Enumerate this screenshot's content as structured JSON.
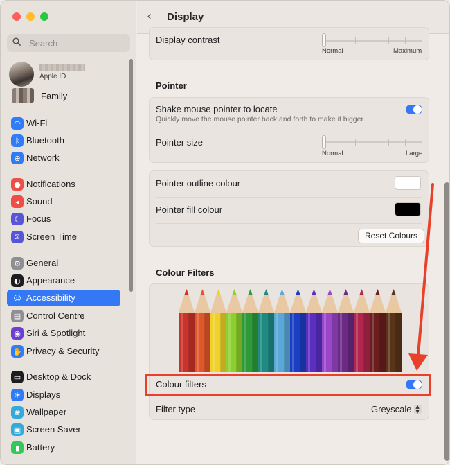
{
  "window": {
    "title": "Display"
  },
  "sidebar": {
    "search_placeholder": "Search",
    "account": {
      "subtitle": "Apple ID",
      "family_label": "Family"
    },
    "items": [
      {
        "label": "Wi-Fi",
        "icon": "wifi-icon",
        "color": "#2f7cf6"
      },
      {
        "label": "Bluetooth",
        "icon": "bluetooth-icon",
        "color": "#2f7cf6"
      },
      {
        "label": "Network",
        "icon": "network-globe-icon",
        "color": "#2f7cf6"
      },
      {
        "label": "Notifications",
        "icon": "notifications-bell-icon",
        "color": "#ee4e45"
      },
      {
        "label": "Sound",
        "icon": "sound-speaker-icon",
        "color": "#ee4e45"
      },
      {
        "label": "Focus",
        "icon": "focus-moon-icon",
        "color": "#5856d6"
      },
      {
        "label": "Screen Time",
        "icon": "screen-time-hourglass-icon",
        "color": "#5856d6"
      },
      {
        "label": "General",
        "icon": "general-gear-icon",
        "color": "#8e8e93"
      },
      {
        "label": "Appearance",
        "icon": "appearance-circle-icon",
        "color": "#1d1d1f"
      },
      {
        "label": "Accessibility",
        "icon": "accessibility-person-icon",
        "color": "#2f7cf6",
        "active": true
      },
      {
        "label": "Control Centre",
        "icon": "control-centre-icon",
        "color": "#8e8e93"
      },
      {
        "label": "Siri & Spotlight",
        "icon": "siri-icon",
        "color": "#6c3fd0"
      },
      {
        "label": "Privacy & Security",
        "icon": "privacy-hand-icon",
        "color": "#2f7cf6"
      },
      {
        "label": "Desktop & Dock",
        "icon": "desktop-dock-icon",
        "color": "#1d1d1f"
      },
      {
        "label": "Displays",
        "icon": "displays-sun-icon",
        "color": "#2f7cf6"
      },
      {
        "label": "Wallpaper",
        "icon": "wallpaper-flower-icon",
        "color": "#34aadc"
      },
      {
        "label": "Screen Saver",
        "icon": "screen-saver-icon",
        "color": "#34aadc"
      },
      {
        "label": "Battery",
        "icon": "battery-icon",
        "color": "#34c759"
      }
    ]
  },
  "main": {
    "contrast": {
      "label": "Display contrast",
      "min_label": "Normal",
      "max_label": "Maximum",
      "value": 0
    },
    "pointer_section": "Pointer",
    "shake": {
      "label": "Shake mouse pointer to locate",
      "description": "Quickly move the mouse pointer back and forth to make it bigger.",
      "on": true
    },
    "pointer_size": {
      "label": "Pointer size",
      "min_label": "Normal",
      "max_label": "Large",
      "value": 0
    },
    "outline_colour": {
      "label": "Pointer outline colour",
      "color": "#ffffff"
    },
    "fill_colour": {
      "label": "Pointer fill colour",
      "color": "#000000"
    },
    "reset_button": "Reset Colours",
    "colour_filters_section": "Colour Filters",
    "colour_filters_toggle": {
      "label": "Colour filters",
      "on": true
    },
    "filter_type": {
      "label": "Filter type",
      "value": "Greyscale"
    },
    "pencil_colors": [
      "#c8332b",
      "#e0572a",
      "#f0d12c",
      "#8ccf2e",
      "#2e9a3a",
      "#1e8a82",
      "#5aa8d8",
      "#1b3fc4",
      "#5a2fc0",
      "#9a46c8",
      "#6a2a86",
      "#b0264e",
      "#6a1e1e",
      "#5a3418"
    ],
    "accent": "#3478f6",
    "annotation_color": "#e8402a"
  }
}
